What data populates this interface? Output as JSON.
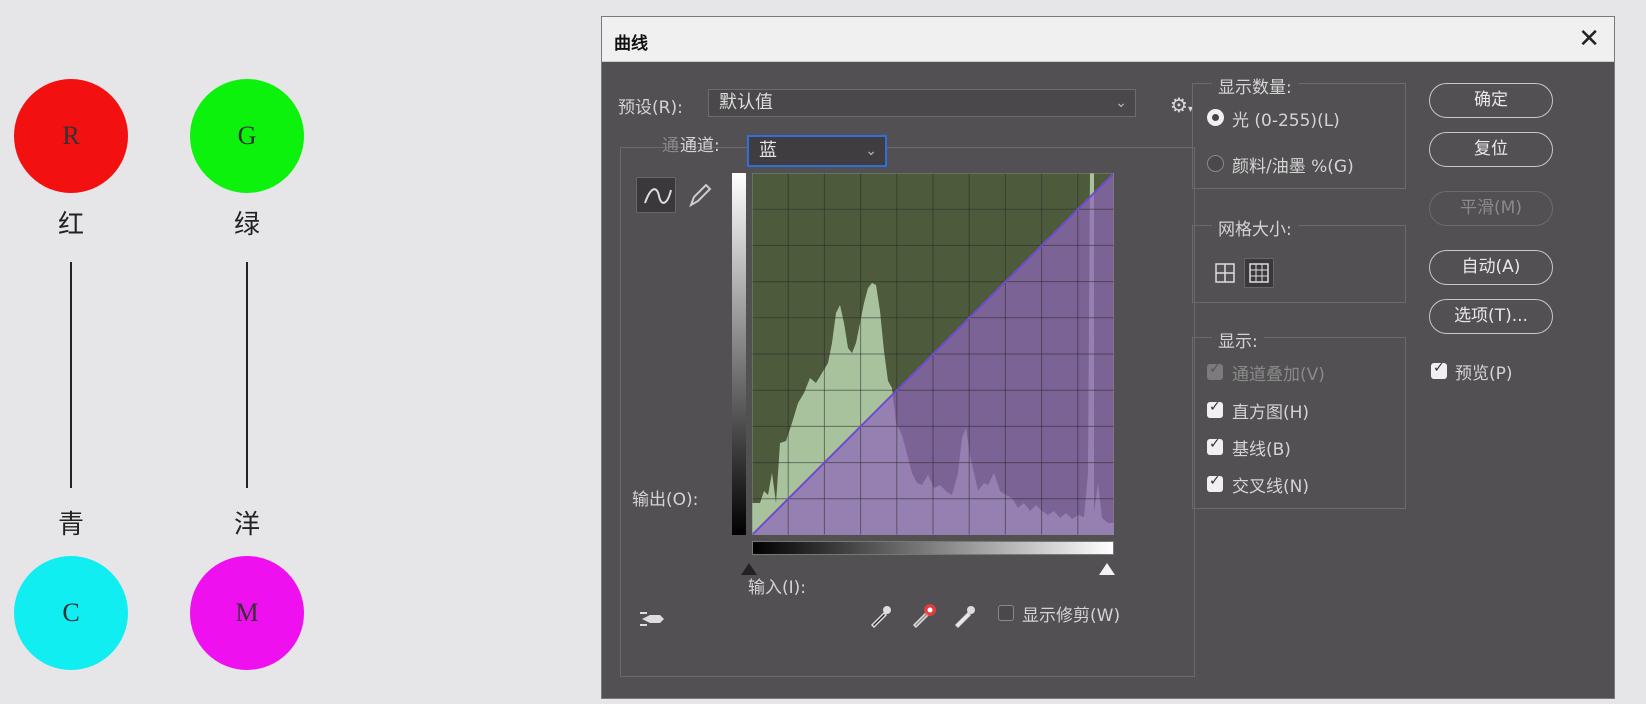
{
  "diagram": {
    "colors": {
      "red": "#f21010",
      "green": "#0df20d",
      "cyan": "#10eef2",
      "magenta": "#ee10ee"
    },
    "circles": [
      {
        "letter": "R",
        "label": "红"
      },
      {
        "letter": "G",
        "label": "绿"
      },
      {
        "letter": "C",
        "label": "青"
      },
      {
        "letter": "M",
        "label": "洋"
      }
    ]
  },
  "dialog": {
    "title": "曲线",
    "close": "✕",
    "preset_label": "预设(R):",
    "preset_value": "默认值",
    "channel_label_ghost": "通",
    "channel_label": "通道:",
    "channel_value": "蓝",
    "output_label": "输出(O):",
    "input_label": "输入(I):",
    "show_clipping": "显示修剪(W)",
    "display_amount": {
      "title": "显示数量:",
      "options": [
        {
          "label": "光 (0-255)(L)",
          "selected": true
        },
        {
          "label": "颜料/油墨 %(G)",
          "selected": false
        }
      ]
    },
    "grid_size": {
      "title": "网格大小:"
    },
    "show": {
      "title": "显示:",
      "items": [
        {
          "label": "通道叠加(V)",
          "checked": true,
          "disabled": true
        },
        {
          "label": "直方图(H)",
          "checked": true,
          "disabled": false
        },
        {
          "label": "基线(B)",
          "checked": true,
          "disabled": false
        },
        {
          "label": "交叉线(N)",
          "checked": true,
          "disabled": false
        }
      ]
    },
    "buttons": {
      "ok": "确定",
      "reset": "复位",
      "smooth": "平滑(M)",
      "auto": "自动(A)",
      "options": "选项(T)..."
    },
    "preview": {
      "label": "预览(P)",
      "checked": true
    }
  }
}
